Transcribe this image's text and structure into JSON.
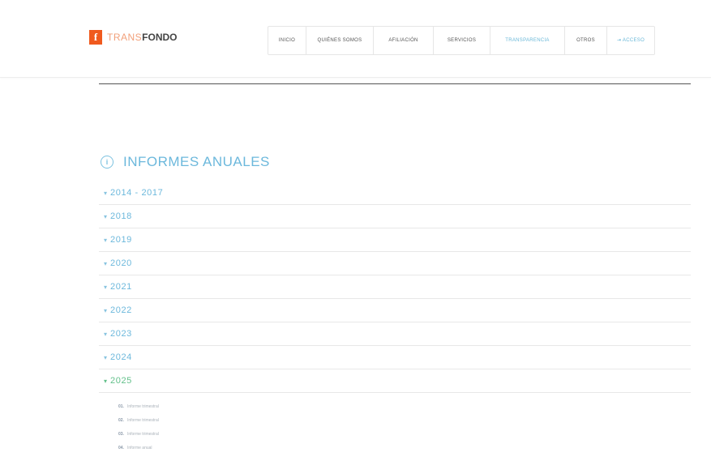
{
  "header": {
    "logo": {
      "mark": "f",
      "pre": "TRANS",
      "main": "FONDO",
      "suffix": ""
    },
    "nav": [
      {
        "label": "INICIO"
      },
      {
        "label": "QUIÉNES SOMOS"
      },
      {
        "label": "AFILIACIÓN"
      },
      {
        "label": "SERVICIOS"
      },
      {
        "label": "TRANSPARENCIA",
        "active": true
      },
      {
        "label": "OTROS"
      },
      {
        "label": "ACCESO",
        "icon": "login-icon"
      }
    ]
  },
  "section": {
    "icon": "info-icon",
    "title": "INFORMES ANUALES"
  },
  "years": [
    {
      "label": "2014 - 2017"
    },
    {
      "label": "2018"
    },
    {
      "label": "2019"
    },
    {
      "label": "2020"
    },
    {
      "label": "2021"
    },
    {
      "label": "2022"
    },
    {
      "label": "2023"
    },
    {
      "label": "2024"
    },
    {
      "label": "2025",
      "open": true
    }
  ],
  "reports_2025": [
    {
      "num": "01.",
      "label": "Informe trimestral"
    },
    {
      "num": "02.",
      "label": "Informe trimestral"
    },
    {
      "num": "03.",
      "label": "Informe trimestral"
    },
    {
      "num": "04.",
      "label": "Informe anual"
    }
  ],
  "colors": {
    "accent": "#6cb8dc",
    "open": "#62c08a",
    "logo": "#f05a1e"
  }
}
